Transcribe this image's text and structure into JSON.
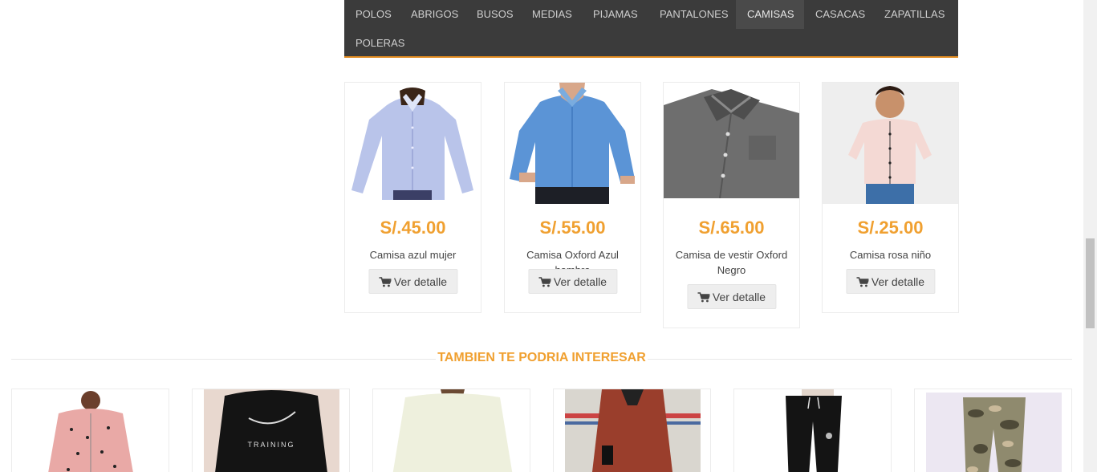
{
  "nav": {
    "items": [
      "POLOS",
      "ABRIGOS",
      "BUSOS",
      "MEDIAS",
      "PIJAMAS",
      "PANTALONES",
      "CAMISAS",
      "CASACAS",
      "ZAPATILLAS",
      "POLERAS"
    ],
    "active": "CAMISAS"
  },
  "products": [
    {
      "price": "S/.45.00",
      "name": "Camisa azul mujer",
      "button": "Ver detalle",
      "image": "woman-blue-shirt"
    },
    {
      "price": "S/.55.00",
      "name": "Camisa Oxford Azul hombre",
      "button": "Ver detalle",
      "image": "man-blue-oxford-shirt"
    },
    {
      "price": "S/.65.00",
      "name": "Camisa de vestir Oxford Negro",
      "button": "Ver detalle",
      "image": "folded-gray-shirt"
    },
    {
      "price": "S/.25.00",
      "name": "Camisa rosa niño",
      "button": "Ver detalle",
      "image": "boy-pink-shirt"
    }
  ],
  "section": {
    "title": "TAMBIEN TE PODRIA INTERESAR"
  },
  "suggestions": [
    {
      "image": "pink-polka-dot-pajama"
    },
    {
      "image": "black-training-sweatshirt"
    },
    {
      "image": "cream-long-sleeve-shirt"
    },
    {
      "image": "rust-long-coat"
    },
    {
      "image": "black-jogger-pants"
    },
    {
      "image": "camouflage-cargo-pants"
    }
  ],
  "colors": {
    "accent": "#f0a030",
    "nav_bg": "#3b3b3b",
    "nav_border": "#e08a1e"
  },
  "icons": {
    "cart": "shopping-cart-icon"
  }
}
